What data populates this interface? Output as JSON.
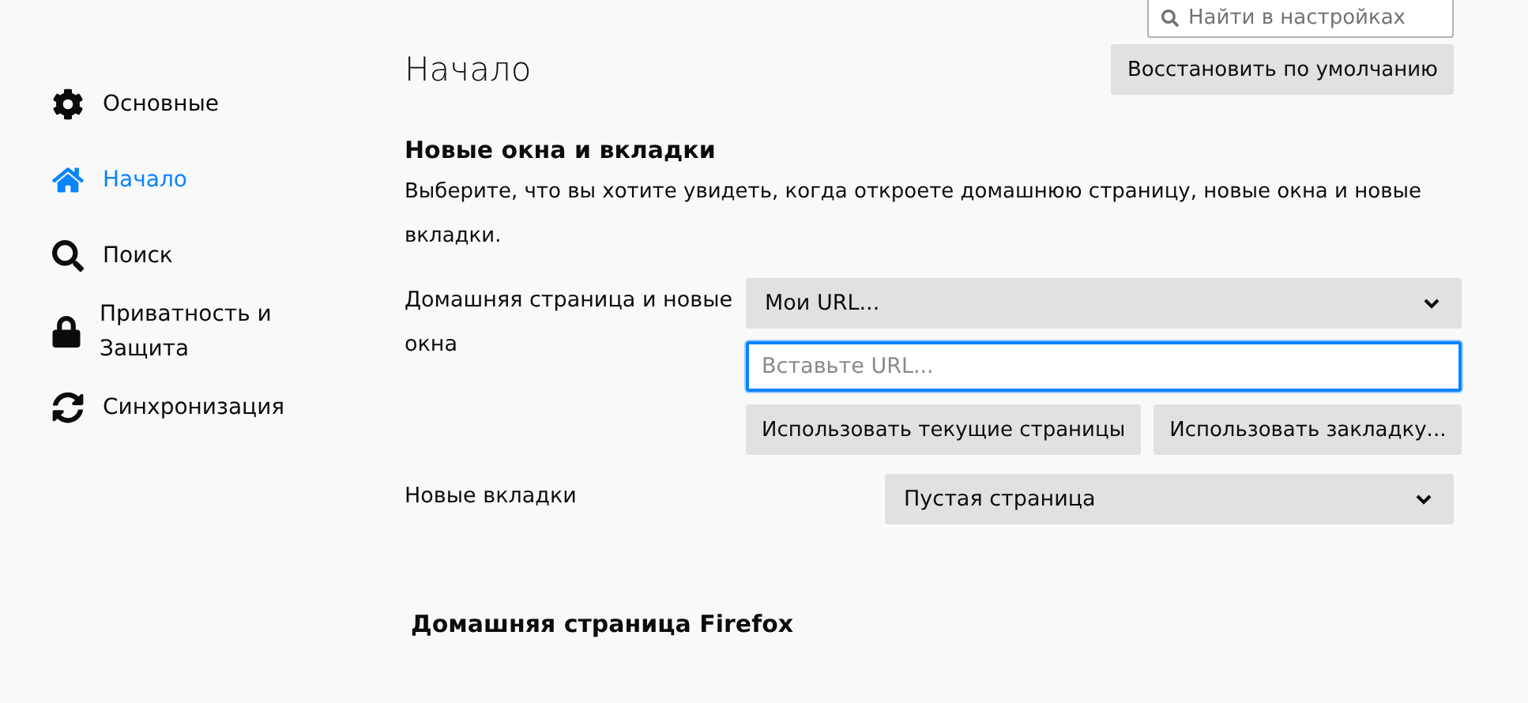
{
  "search": {
    "placeholder": "Найти в настройках"
  },
  "sidebar": {
    "items": [
      {
        "label": "Основные",
        "kind": "gear",
        "selected": false
      },
      {
        "label": "Начало",
        "kind": "home",
        "selected": true
      },
      {
        "label": "Поиск",
        "kind": "search",
        "selected": false
      },
      {
        "label": "Приватность и Защита",
        "kind": "lock",
        "selected": false
      },
      {
        "label": "Синхронизация",
        "kind": "sync",
        "selected": false
      }
    ]
  },
  "page_title": "Начало",
  "restore_button": {
    "label": "Восстановить по умолчанию"
  },
  "section": {
    "title": "Новые окна и вкладки",
    "description": "Выберите, что вы хотите увидеть, когда откроете домашнюю страницу, новые окна и новые вкладки.",
    "homepage": {
      "label": "Домашняя страница и новые окна",
      "select": "Мои URL...",
      "url_placeholder": "Вставьте URL...",
      "buttons": [
        {
          "label": "Использовать текущие страницы"
        },
        {
          "label": "Использовать закладку..."
        }
      ]
    },
    "new_tabs": {
      "label": "Новые вкладки",
      "select": "Пустая страница"
    }
  },
  "section2": {
    "title": "Домашняя страница Firefox"
  }
}
